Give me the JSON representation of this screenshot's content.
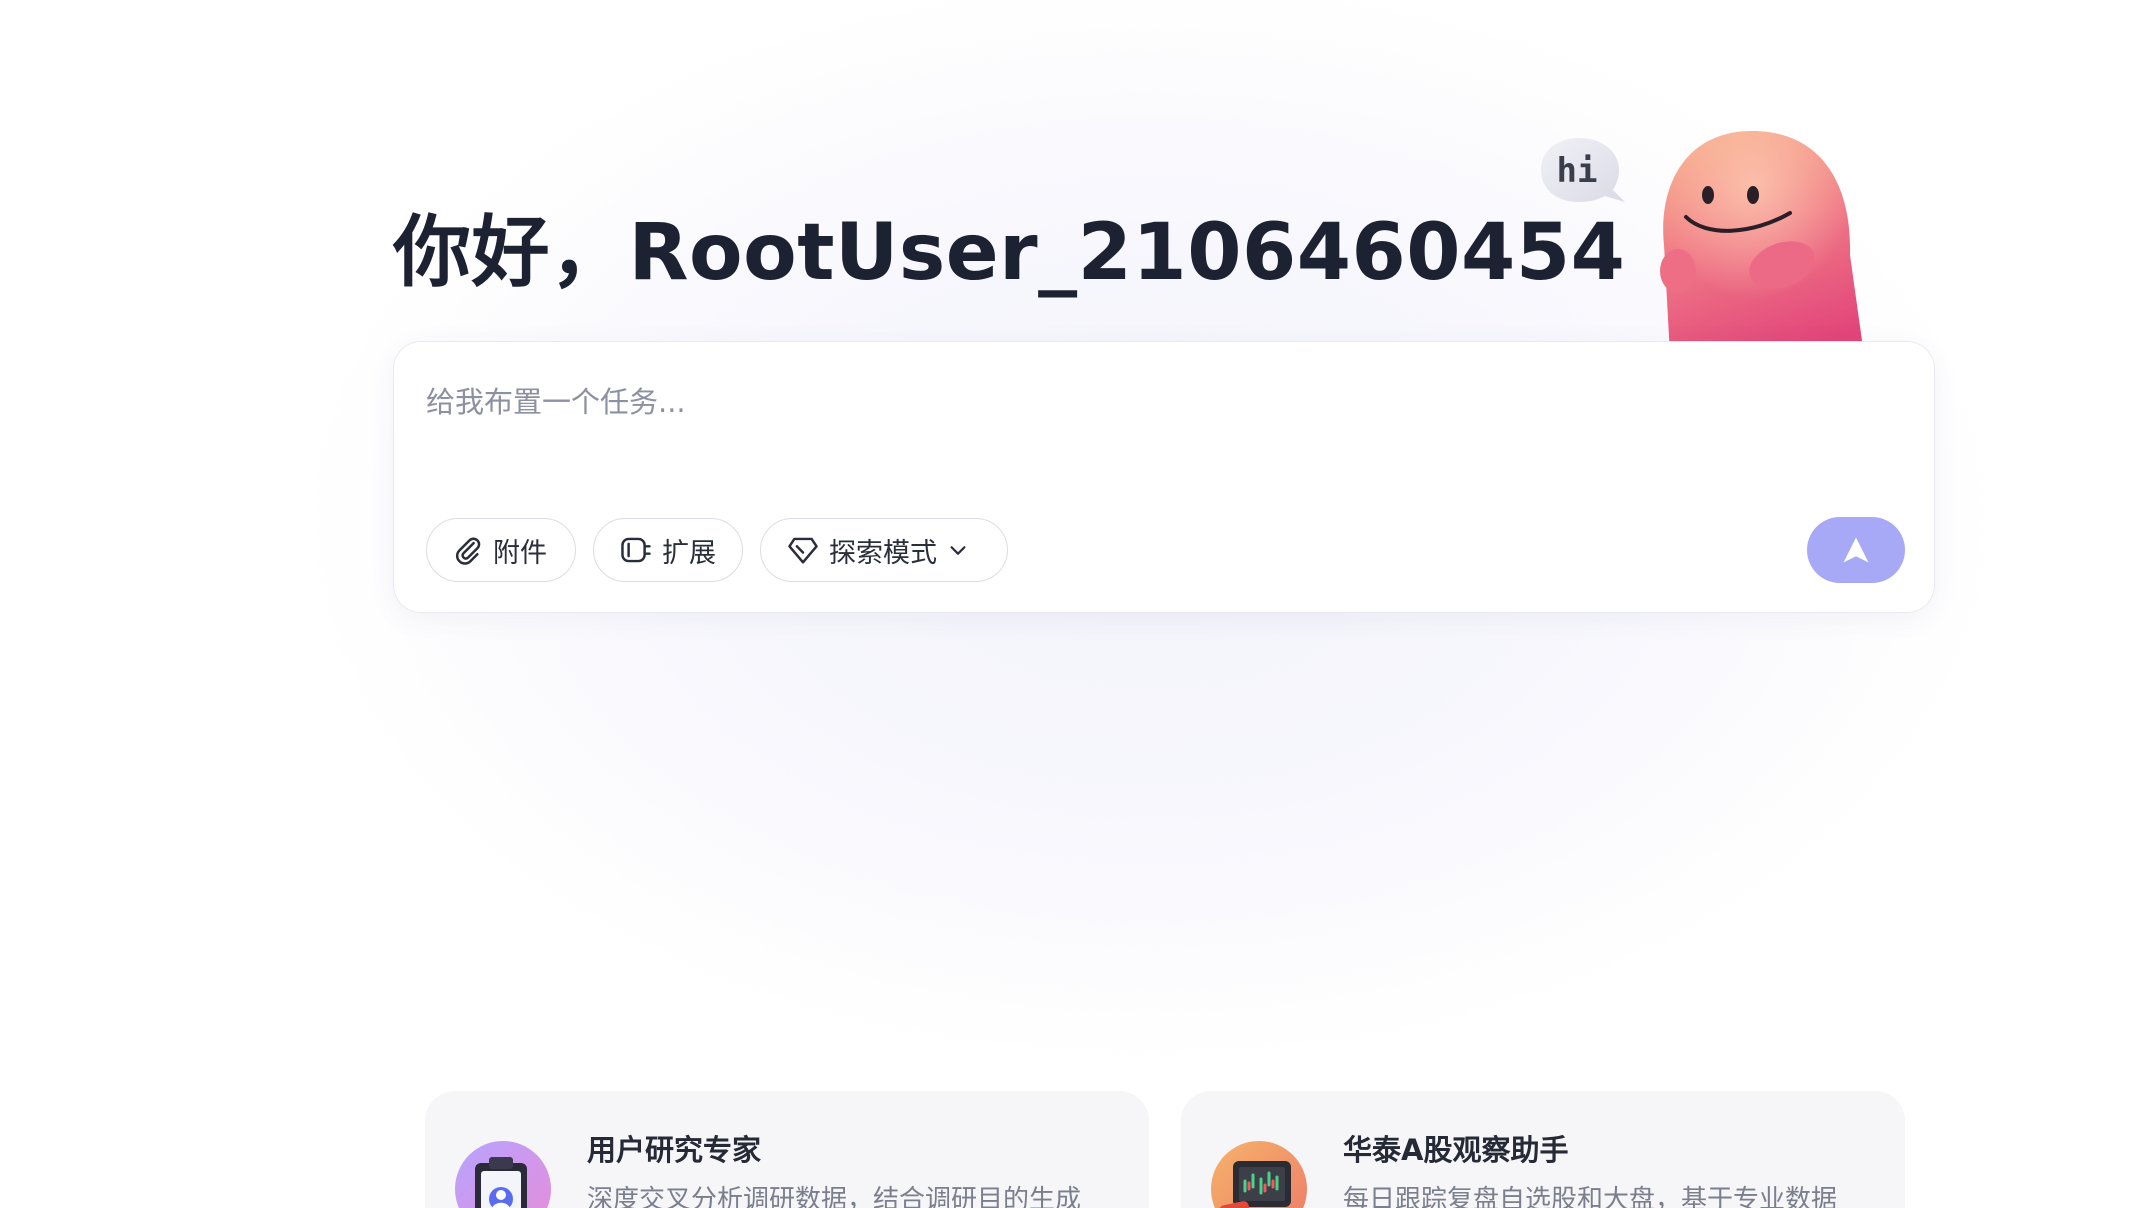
{
  "greeting": {
    "text": "你好，RootUser_2106460454"
  },
  "mascot": {
    "bubble_text": "hi",
    "icon": "mascot-blob-icon"
  },
  "composer": {
    "placeholder": "给我布置一个任务...",
    "value": "",
    "attach_label": "附件",
    "extend_label": "扩展",
    "mode_label": "探索模式",
    "icons": {
      "attach": "paperclip-icon",
      "extend": "plugin-icon",
      "mode": "diamond-icon",
      "mode_dropdown": "chevron-down-icon",
      "send": "send-arrow-icon"
    },
    "send_color": "#a7a9f7"
  },
  "agents": [
    {
      "title": "用户研究专家",
      "description": "深度交叉分析调研数据，结合调研目的生成",
      "icon": "clipboard-user-icon"
    },
    {
      "title": "华泰A股观察助手",
      "description": "每日跟踪复盘自选股和大盘，基于专业数据",
      "icon": "stock-chart-icon"
    }
  ]
}
